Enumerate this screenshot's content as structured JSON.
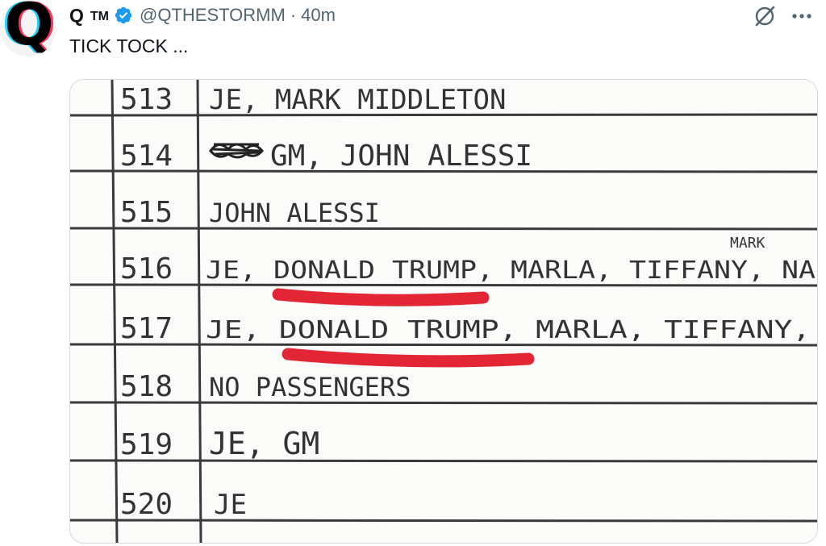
{
  "tweet": {
    "avatar_letter": "Q",
    "display_name": "Q",
    "name_suffix": "TM",
    "handle": "@QTHESTORMM",
    "separator": "·",
    "time": "40m",
    "text": "TICK TOCK ...",
    "icons": {
      "verified": "verified-badge-icon",
      "grok": "grok-icon",
      "more": "more-icon"
    },
    "colors": {
      "verified": "#1d9bf0",
      "secondary": "#536471",
      "underline": "#e32636"
    }
  },
  "media": {
    "rows": [
      {
        "number": "513",
        "entry": "JE, MARK MIDDLETON"
      },
      {
        "number": "514",
        "entry": "GM, JOHN ALESSI"
      },
      {
        "number": "515",
        "entry": "JOHN ALESSI"
      },
      {
        "number": "516",
        "entry": "JE, DONALD TRUMP, MARLA, TIFFANY, NA",
        "note": "MARK"
      },
      {
        "number": "517",
        "entry": "JE, DONALD TRUMP, MARLA, TIFFANY,"
      },
      {
        "number": "518",
        "entry": "NO PASSENGERS"
      },
      {
        "number": "519",
        "entry": "JE, GM"
      },
      {
        "number": "520",
        "entry": "JE"
      }
    ]
  }
}
